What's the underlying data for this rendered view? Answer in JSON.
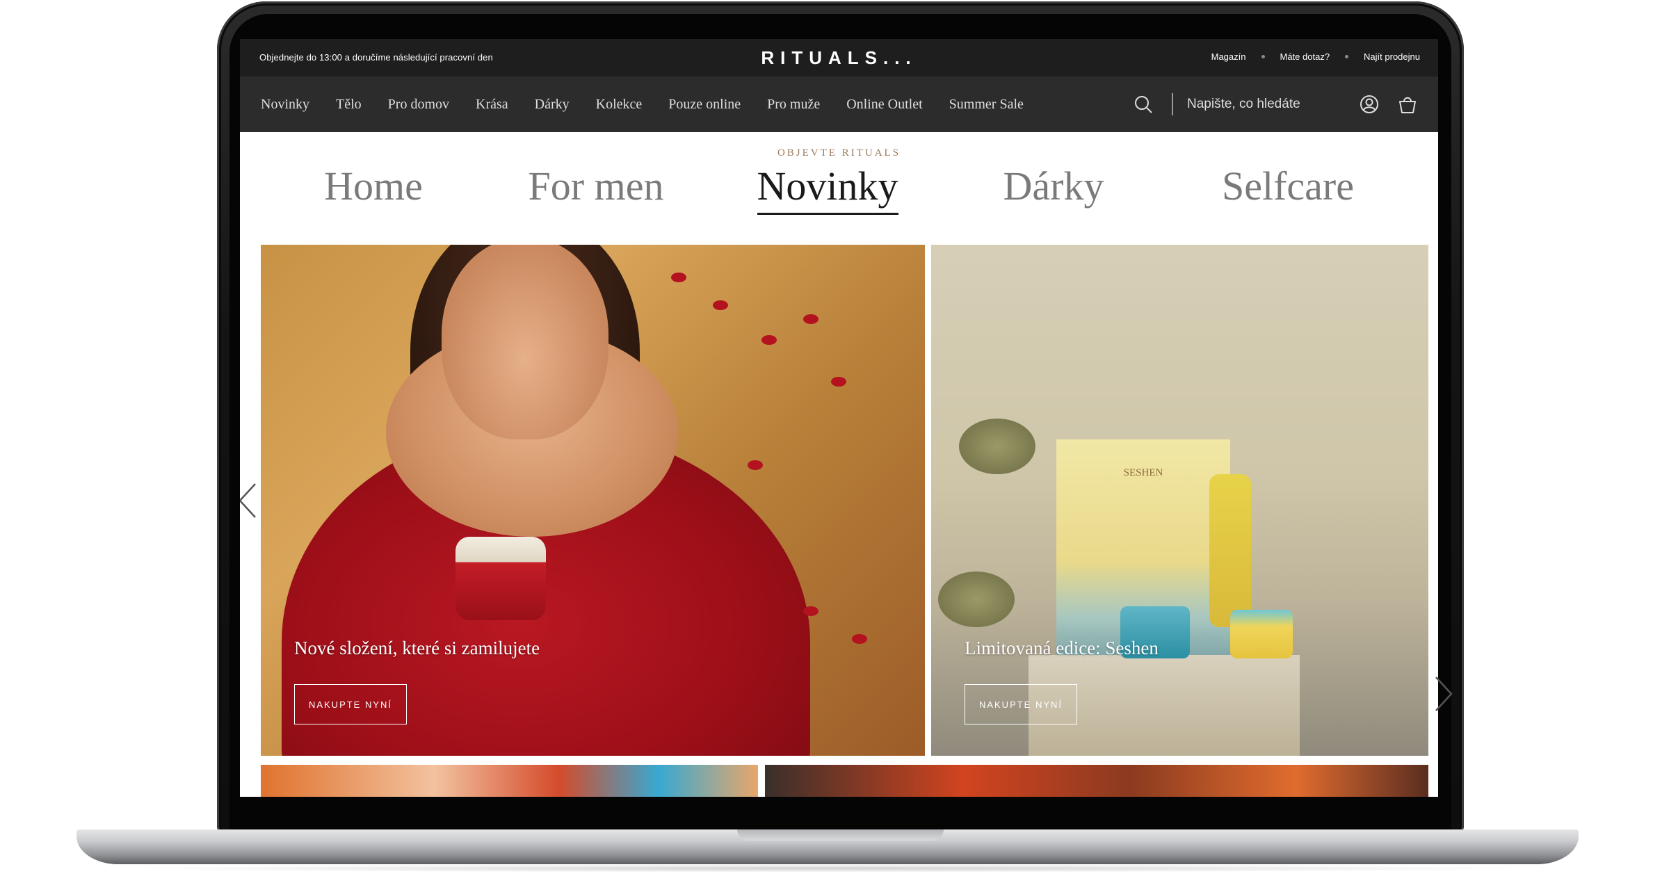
{
  "topbar": {
    "promo": "Objednejte do 13:00 a doručíme následující pracovní den",
    "logo": "RITUALS...",
    "links": [
      "Magazín",
      "Máte dotaz?",
      "Najít prodejnu"
    ]
  },
  "nav": {
    "items": [
      "Novinky",
      "Tělo",
      "Pro domov",
      "Krása",
      "Dárky",
      "Kolekce",
      "Pouze online",
      "Pro muže",
      "Online Outlet",
      "Summer Sale"
    ],
    "search_placeholder": "Napište, co hledáte"
  },
  "discover": {
    "label": "OBJEVTE RITUALS",
    "tabs": [
      "Home",
      "For men",
      "Novinky",
      "Dárky",
      "Selfcare"
    ],
    "active_tab": "Novinky"
  },
  "cards": [
    {
      "title": "Nové složení, které si zamilujete",
      "button": "NAKUPTE NYNÍ"
    },
    {
      "title": "Limitovaná edice: Seshen",
      "button": "NAKUPTE NYNÍ"
    }
  ],
  "product_label": "SESHEN",
  "colors": {
    "topbar_bg": "#1e1e1e",
    "navbar_bg": "#2c2c2c",
    "accent": "#9a7a5a"
  },
  "icons": {
    "search": "search-icon",
    "account": "account-icon",
    "bag": "shopping-bag-icon",
    "prev": "chevron-left-icon",
    "next": "chevron-right-icon"
  }
}
